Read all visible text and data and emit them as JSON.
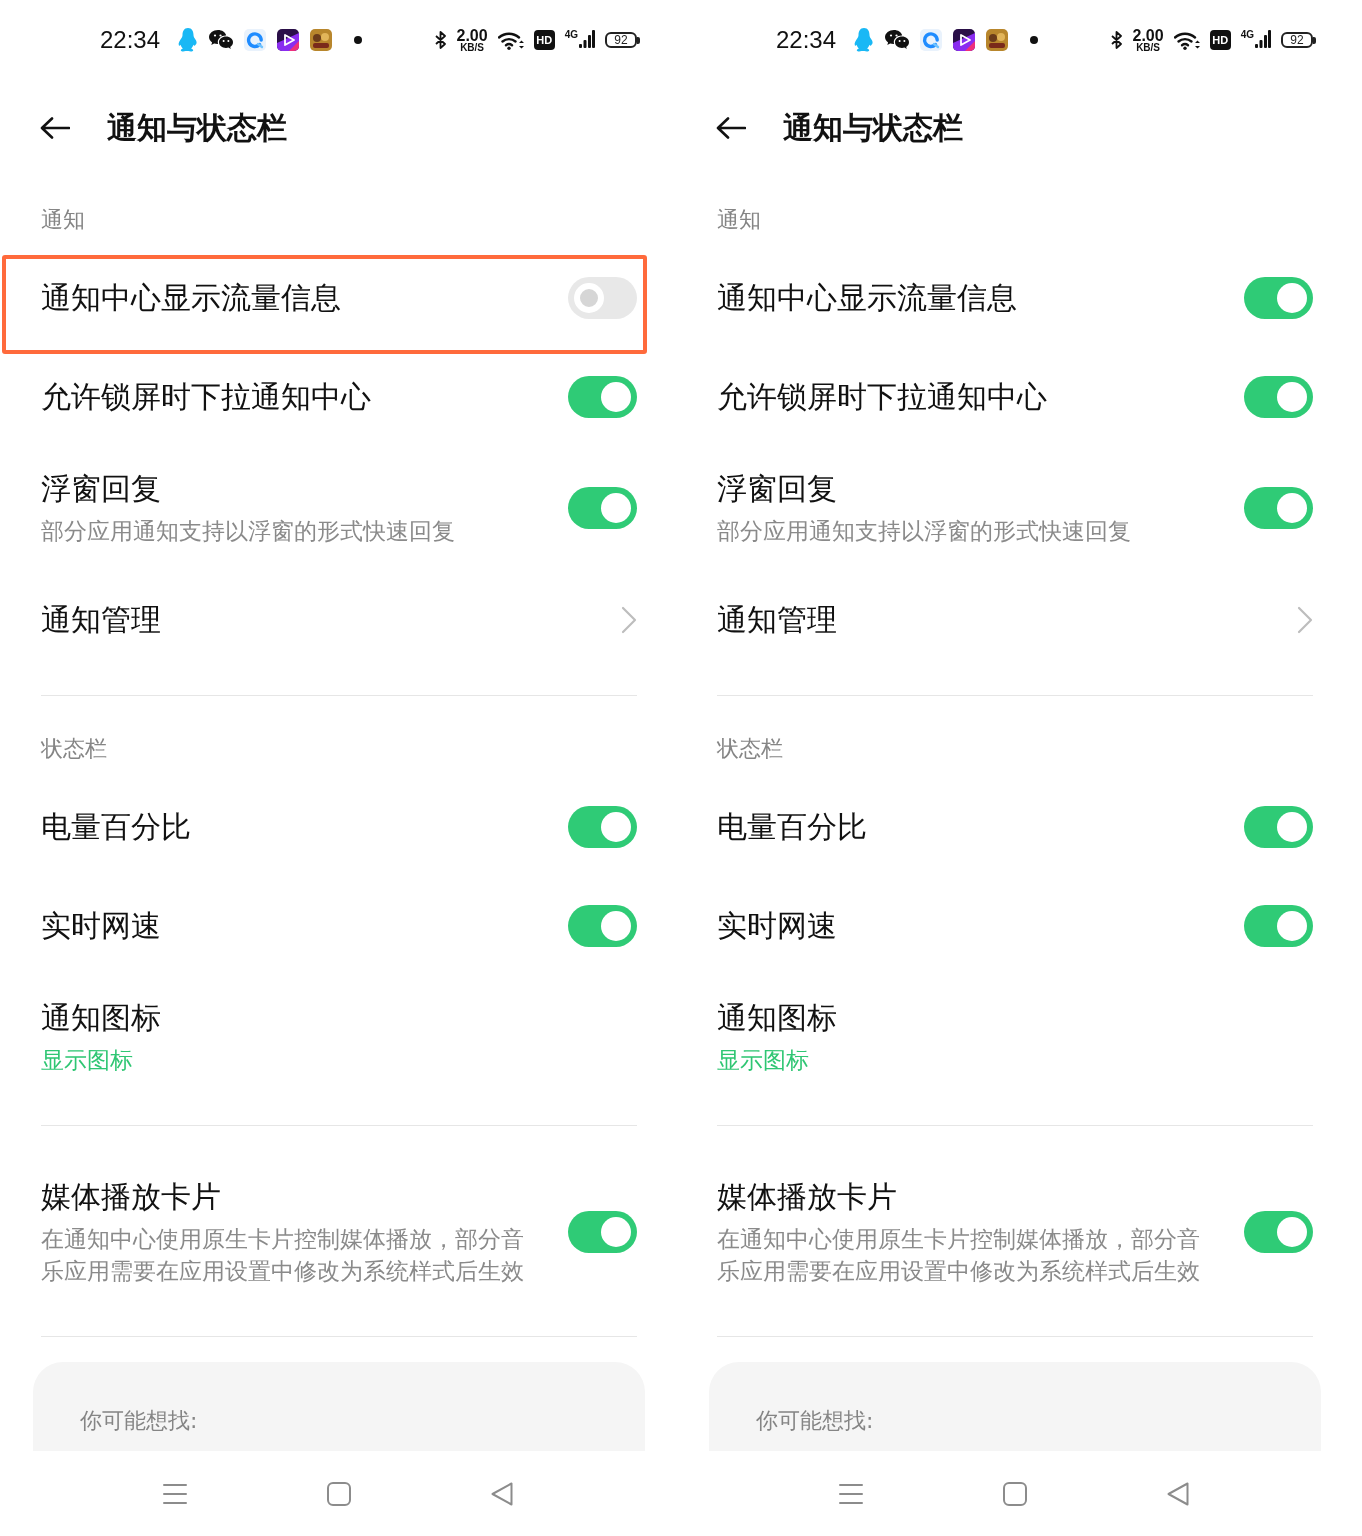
{
  "screens": [
    {
      "status_bar": {
        "time": "22:34",
        "net_speed": "2.00",
        "net_speed_unit": "KB/S",
        "hd": "HD",
        "network_type": "4G",
        "battery": "92"
      },
      "header": {
        "title": "通知与状态栏"
      },
      "sections": [
        {
          "header": "通知",
          "items": [
            {
              "kind": "toggle",
              "title": "通知中心显示流量信息",
              "on": false,
              "highlighted": true
            },
            {
              "kind": "toggle",
              "title": "允许锁屏时下拉通知中心",
              "on": true,
              "highlighted": false
            },
            {
              "kind": "toggle",
              "title": "浮窗回复",
              "subtitle": "部分应用通知支持以浮窗的形式快速回复",
              "on": true,
              "highlighted": false
            },
            {
              "kind": "link",
              "title": "通知管理",
              "highlighted": false
            }
          ]
        },
        {
          "header": "状态栏",
          "items": [
            {
              "kind": "toggle",
              "title": "电量百分比",
              "on": true,
              "highlighted": false
            },
            {
              "kind": "toggle",
              "title": "实时网速",
              "on": true,
              "highlighted": false
            },
            {
              "kind": "picker",
              "title": "通知图标",
              "value": "显示图标",
              "highlighted": false
            }
          ]
        },
        {
          "items": [
            {
              "kind": "toggle",
              "title": "媒体播放卡片",
              "subtitle": "在通知中心使用原生卡片控制媒体播放，部分音乐应用需要在应用设置中修改为系统样式后生效",
              "on": true,
              "highlighted": false
            }
          ]
        }
      ],
      "suggestions": {
        "title": "你可能想找:"
      }
    },
    {
      "status_bar": {
        "time": "22:34",
        "net_speed": "2.00",
        "net_speed_unit": "KB/S",
        "hd": "HD",
        "network_type": "4G",
        "battery": "92"
      },
      "header": {
        "title": "通知与状态栏"
      },
      "sections": [
        {
          "header": "通知",
          "items": [
            {
              "kind": "toggle",
              "title": "通知中心显示流量信息",
              "on": true,
              "highlighted": false
            },
            {
              "kind": "toggle",
              "title": "允许锁屏时下拉通知中心",
              "on": true,
              "highlighted": false
            },
            {
              "kind": "toggle",
              "title": "浮窗回复",
              "subtitle": "部分应用通知支持以浮窗的形式快速回复",
              "on": true,
              "highlighted": false
            },
            {
              "kind": "link",
              "title": "通知管理",
              "highlighted": false
            }
          ]
        },
        {
          "header": "状态栏",
          "items": [
            {
              "kind": "toggle",
              "title": "电量百分比",
              "on": true,
              "highlighted": false
            },
            {
              "kind": "toggle",
              "title": "实时网速",
              "on": true,
              "highlighted": false
            },
            {
              "kind": "picker",
              "title": "通知图标",
              "value": "显示图标",
              "highlighted": false
            }
          ]
        },
        {
          "items": [
            {
              "kind": "toggle",
              "title": "媒体播放卡片",
              "subtitle": "在通知中心使用原生卡片控制媒体播放，部分音乐应用需要在应用设置中修改为系统样式后生效",
              "on": true,
              "highlighted": false
            }
          ]
        }
      ],
      "suggestions": {
        "title": "你可能想找:"
      }
    }
  ]
}
